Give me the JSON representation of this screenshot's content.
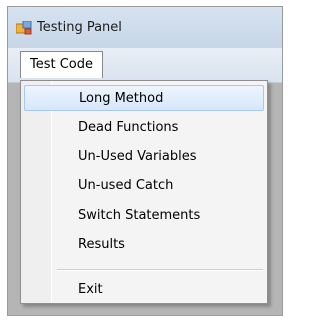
{
  "window": {
    "title": "Testing Panel"
  },
  "menubar": {
    "menu_label": "Test Code"
  },
  "dropdown": {
    "items": [
      {
        "label": "Long Method",
        "highlighted": true
      },
      {
        "label": "Dead Functions"
      },
      {
        "label": "Un-Used Variables"
      },
      {
        "label": "Un-used Catch"
      },
      {
        "label": "Switch Statements"
      },
      {
        "label": "Results"
      },
      {
        "label": "Exit"
      }
    ]
  },
  "colors": {
    "highlight_border": "#a9c8ef",
    "client_background": "#b5b5b5"
  }
}
